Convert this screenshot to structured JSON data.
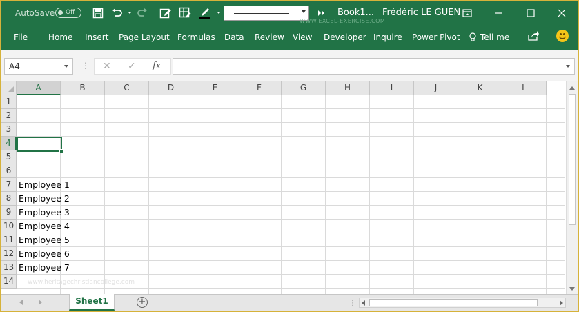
{
  "titlebar": {
    "autosave_label": "AutoSave",
    "autosave_state": "Off",
    "book_title": "Book1...",
    "user_name": "Frédéric LE GUEN",
    "watermark": "WWW.EXCEL-EXERCISE.COM",
    "icons": [
      "save-icon",
      "undo-icon",
      "redo-icon",
      "edit-icon",
      "form-icon",
      "font-color-icon",
      "more-icon",
      "ribbon-display-icon",
      "minimize-icon",
      "maximize-icon",
      "close-icon"
    ]
  },
  "ribbon": {
    "tabs": [
      "File",
      "Home",
      "Insert",
      "Page Layout",
      "Formulas",
      "Data",
      "Review",
      "View",
      "Developer",
      "Inquire",
      "Power Pivot"
    ],
    "tell_me": "Tell me"
  },
  "formula_bar": {
    "name_box": "A4",
    "formula": ""
  },
  "grid": {
    "columns": [
      "A",
      "B",
      "C",
      "D",
      "E",
      "F",
      "G",
      "H",
      "I",
      "J",
      "K",
      "L"
    ],
    "rows": [
      "1",
      "2",
      "3",
      "4",
      "5",
      "6",
      "7",
      "8",
      "9",
      "10",
      "11",
      "12",
      "13",
      "14"
    ],
    "selected_column": "A",
    "selected_row": "4",
    "cells": [
      {
        "ref": "A7",
        "row": 7,
        "value": "Employee 1"
      },
      {
        "ref": "A8",
        "row": 8,
        "value": "Employee 2"
      },
      {
        "ref": "A9",
        "row": 9,
        "value": "Employee 3"
      },
      {
        "ref": "A10",
        "row": 10,
        "value": "Employee 4"
      },
      {
        "ref": "A11",
        "row": 11,
        "value": "Employee 5"
      },
      {
        "ref": "A12",
        "row": 12,
        "value": "Employee 6"
      },
      {
        "ref": "A13",
        "row": 13,
        "value": "Employee 7"
      }
    ],
    "faint_watermark": "www.heritagechristiancollege.com"
  },
  "sheets": {
    "tabs": [
      "Sheet1"
    ],
    "active": "Sheet1"
  },
  "colors": {
    "excel_green": "#217346",
    "window_border": "#d6b23a"
  }
}
